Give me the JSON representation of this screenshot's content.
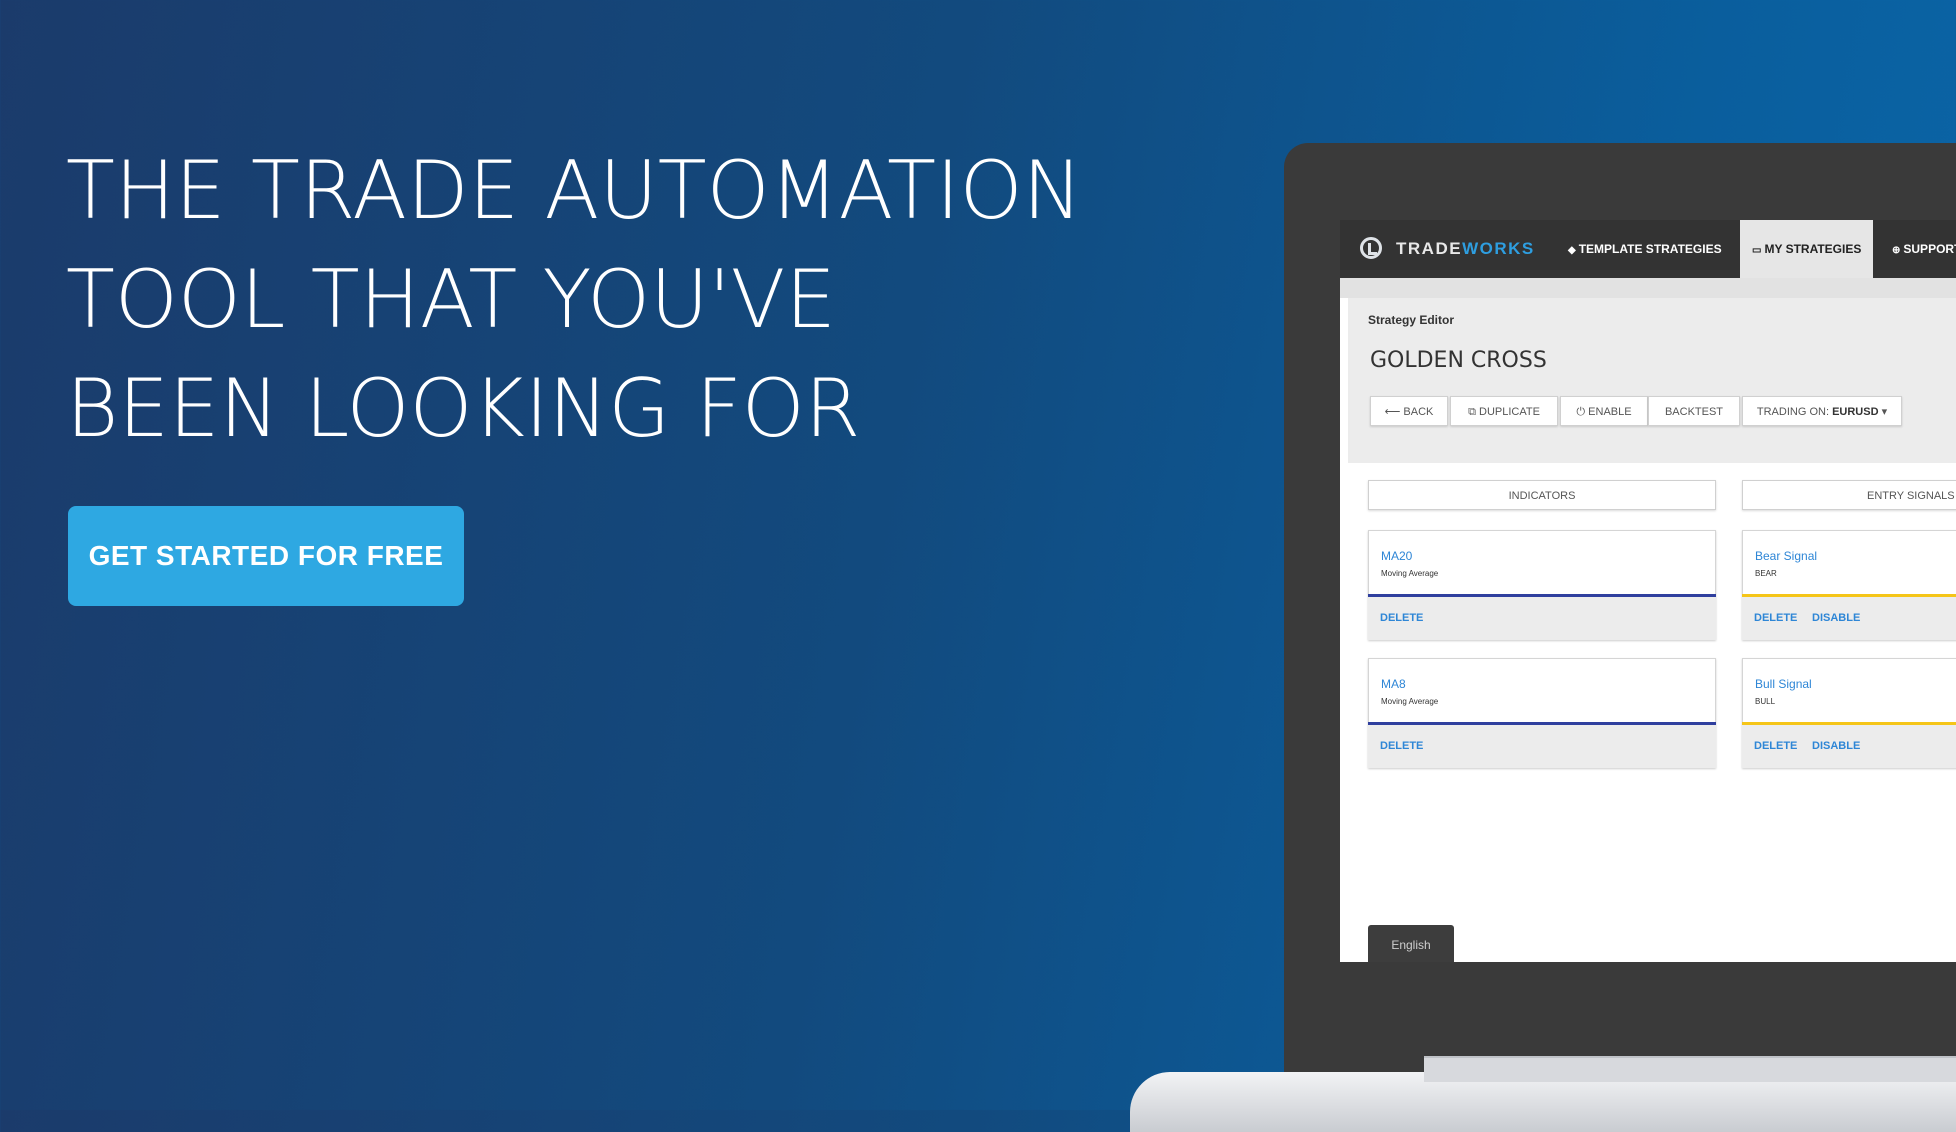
{
  "hero": {
    "title_lines": [
      "THE TRADE AUTOMATION",
      "TOOL THAT YOU'VE",
      "BEEN LOOKING FOR"
    ],
    "cta_label": "GET STARTED FOR FREE"
  },
  "app": {
    "logo": {
      "part1": "TRADE",
      "part2": "WORKS"
    },
    "nav": [
      {
        "label": "TEMPLATE STRATEGIES",
        "icon": "tag-icon",
        "glyph": "◆"
      },
      {
        "label": "MY STRATEGIES",
        "icon": "folder-icon",
        "glyph": "▭",
        "active": true
      },
      {
        "label": "SUPPORT",
        "icon": "lifebuoy-icon",
        "glyph": "⊕"
      }
    ],
    "breadcrumb": "Strategy Editor",
    "strategy_name": "GOLDEN CROSS",
    "toolbar": {
      "back": "BACK",
      "duplicate": "DUPLICATE",
      "enable": "ENABLE",
      "backtest": "BACKTEST",
      "trading_on_label": "TRADING ON:",
      "trading_on_value": "EURUSD"
    },
    "columns": {
      "indicators": "INDICATORS",
      "entry_signals": "ENTRY SIGNALS"
    },
    "indicators": [
      {
        "name": "MA20",
        "type": "Moving Average",
        "action": "DELETE"
      },
      {
        "name": "MA8",
        "type": "Moving Average",
        "action": "DELETE"
      }
    ],
    "signals": [
      {
        "name": "Bear Signal",
        "type": "BEAR",
        "delete": "DELETE",
        "disable": "DISABLE"
      },
      {
        "name": "Bull Signal",
        "type": "BULL",
        "delete": "DELETE",
        "disable": "DISABLE"
      }
    ],
    "language": "English",
    "colors": {
      "indicator_line": "#2f3f9e",
      "signal_line": "#f5c518",
      "link": "#2e86d6",
      "cta": "#2ea8e2"
    }
  }
}
